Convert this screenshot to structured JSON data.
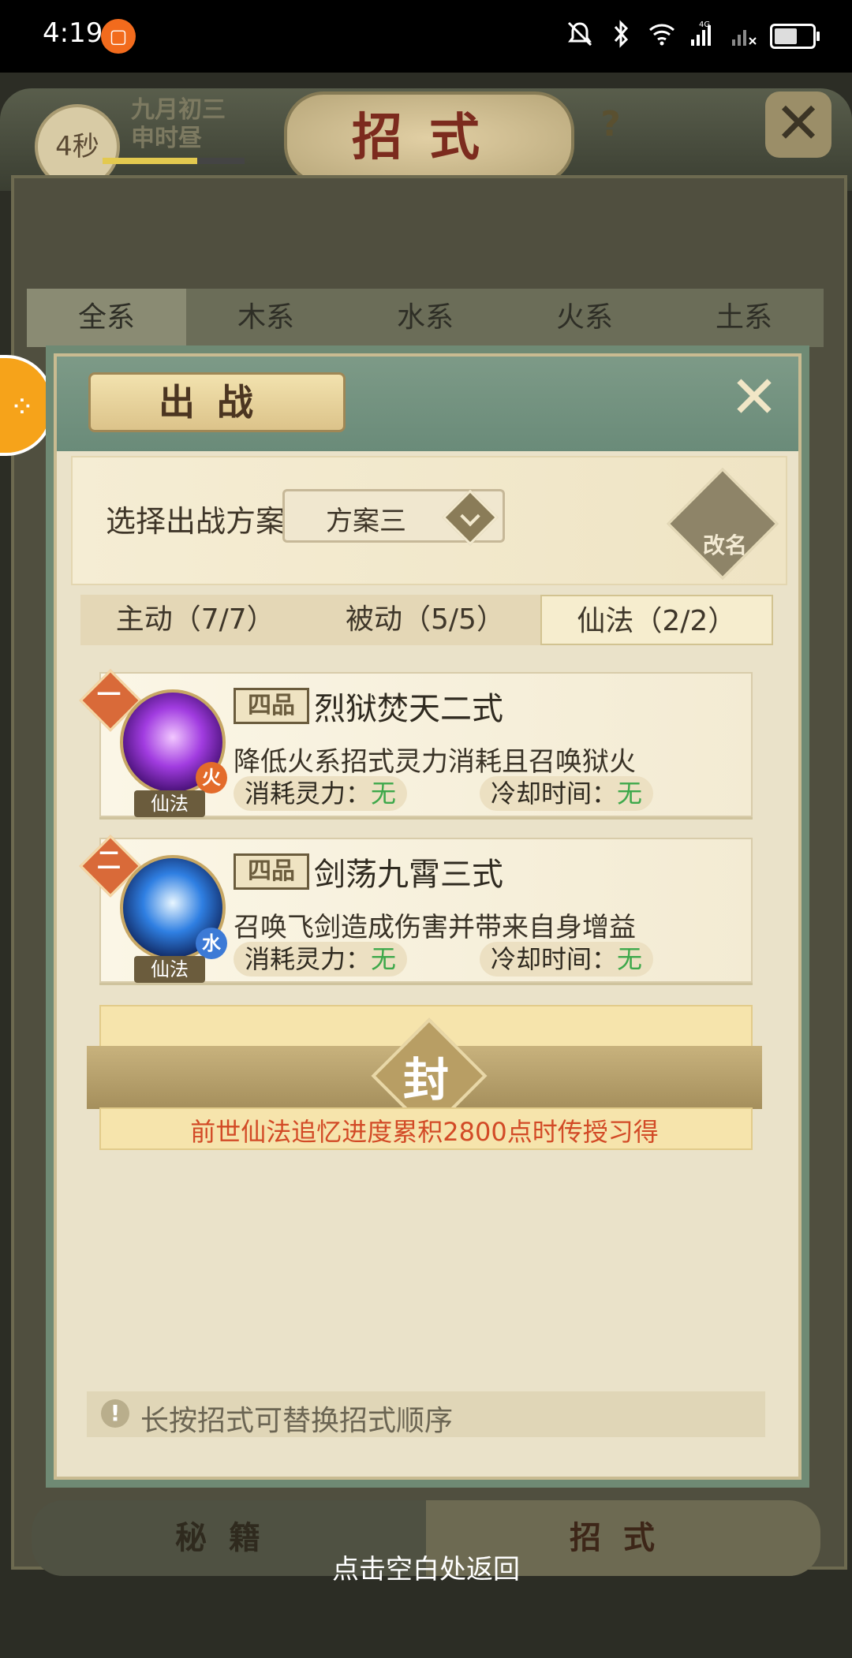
{
  "status": {
    "time": "4:19",
    "network": "4G"
  },
  "game": {
    "timer": "4秒",
    "date_line1": "九月初三",
    "date_line2": "申时昼",
    "title": "招式",
    "help": "?",
    "element_tabs": [
      "全系",
      "木系",
      "水系",
      "火系",
      "土系"
    ],
    "bottom_tabs": [
      "秘籍",
      "招式"
    ],
    "return_hint": "点击空白处返回"
  },
  "dialog": {
    "title": "出战",
    "scheme_label": "选择出战方案：",
    "scheme_value": "方案三",
    "rename_label": "改名",
    "subtabs": [
      "主动（7/7）",
      "被动（5/5）",
      "仙法（2/2）"
    ],
    "active_subtab": 2,
    "skills": [
      {
        "rank": "一",
        "grade": "四品",
        "name": "烈狱焚天二式",
        "desc": "降低火系招式灵力消耗且召唤狱火",
        "element": "火",
        "type": "仙法",
        "cost_label": "消耗灵力：",
        "cost_value": "无",
        "cd_label": "冷却时间：",
        "cd_value": "无"
      },
      {
        "rank": "二",
        "grade": "四品",
        "name": "剑荡九霄三式",
        "desc": "召唤飞剑造成伤害并带来自身增益",
        "element": "水",
        "type": "仙法",
        "cost_label": "消耗灵力：",
        "cost_value": "无",
        "cd_label": "冷却时间：",
        "cd_value": "无"
      }
    ],
    "sealed": {
      "char": "封",
      "text": "前世仙法追忆进度累积2800点时传授习得"
    },
    "hint": "长按招式可替换招式顺序"
  }
}
